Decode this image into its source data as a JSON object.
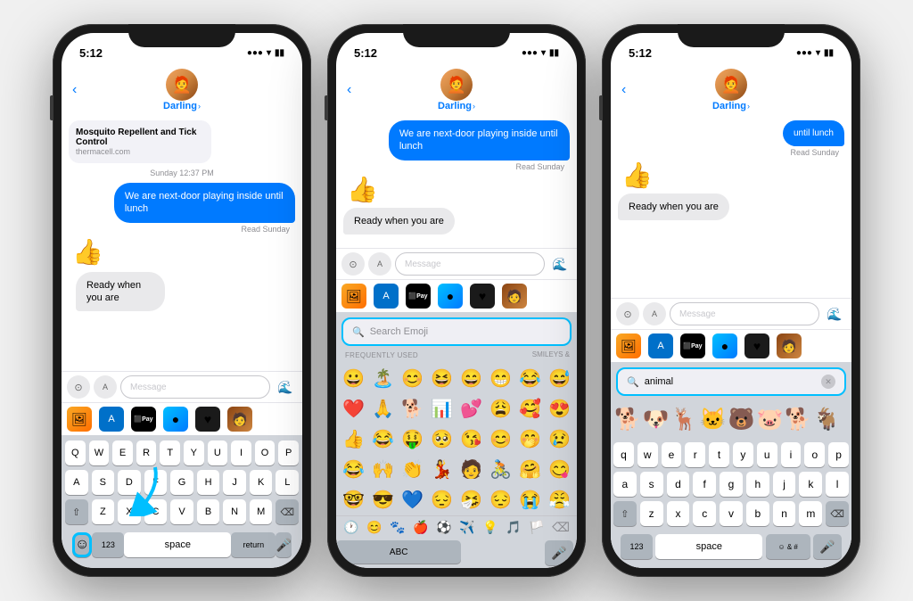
{
  "phones": [
    {
      "id": "phone1",
      "status_time": "5:12",
      "contact": "Darling",
      "messages": [
        {
          "type": "link",
          "title": "Mosquito Repellent and Tick Control",
          "url": "thermacell.com"
        },
        {
          "type": "timestamp",
          "text": "Sunday 12:37 PM"
        },
        {
          "type": "sent",
          "text": "We are next-door playing inside until lunch"
        },
        {
          "type": "read",
          "text": "Read Sunday"
        },
        {
          "type": "thumbs_up"
        },
        {
          "type": "received_plain",
          "text": "Ready when you are"
        }
      ],
      "input_placeholder": "Message",
      "keyboard_type": "alpha",
      "show_emoji_arrow": true,
      "show_app_strip": true
    },
    {
      "id": "phone2",
      "status_time": "5:12",
      "contact": "Darling",
      "messages": [
        {
          "type": "sent",
          "text": "We are next-door playing inside until lunch"
        },
        {
          "type": "read",
          "text": "Read Sunday"
        },
        {
          "type": "thumbs_up"
        },
        {
          "type": "received_plain",
          "text": "Ready when you are"
        }
      ],
      "input_placeholder": "Message",
      "keyboard_type": "emoji",
      "show_app_strip": true,
      "emoji_search_placeholder": "Search Emoji",
      "emoji_sections": {
        "frequently_used": "FREQUENTLY USED",
        "smileys": "SMILEYS &",
        "emojis_row1": [
          "😀",
          "🏝️",
          "😊",
          "😆",
          "😄",
          "😁",
          "😂"
        ],
        "emojis_row2": [
          "❤️",
          "🙏",
          "🐕",
          "📊",
          "💕",
          "😩",
          "🥰"
        ],
        "emojis_row3": [
          "👍",
          "😂",
          "🤑",
          "🥺",
          "😘",
          "😊"
        ],
        "emojis_row4": [
          "😂",
          "🙌",
          "👏",
          "💃",
          "🧑",
          "🚴"
        ],
        "emojis_row5": [
          "🤓",
          "😎",
          "💙",
          "😔",
          "🤧",
          "😔"
        ]
      },
      "emoji_categories": [
        "🕐",
        "😊",
        "🐾",
        "🍎",
        "⚽",
        "✈️",
        "💡",
        "🎵",
        "🏳️",
        "⌫"
      ]
    },
    {
      "id": "phone3",
      "status_time": "5:12",
      "contact": "Darling",
      "messages": [
        {
          "type": "sent",
          "text": "until lunch"
        },
        {
          "type": "read",
          "text": "Read Sunday"
        },
        {
          "type": "thumbs_up"
        },
        {
          "type": "received_plain",
          "text": "Ready when you are"
        }
      ],
      "input_placeholder": "Message",
      "keyboard_type": "emoji_search",
      "show_app_strip": true,
      "emoji_search_value": "animal",
      "animal_emojis": [
        "🐕",
        "🐶",
        "🦌",
        "🐱",
        "🐻",
        "🐷",
        "🐕"
      ],
      "keyboard_rows": [
        [
          "q",
          "w",
          "e",
          "r",
          "t",
          "y",
          "u",
          "i",
          "o",
          "p"
        ],
        [
          "a",
          "s",
          "d",
          "f",
          "g",
          "h",
          "j",
          "k",
          "l"
        ],
        [
          "z",
          "x",
          "c",
          "v",
          "b",
          "n",
          "m"
        ]
      ]
    }
  ],
  "icons": {
    "back": "‹",
    "wifi": "▾",
    "battery": "▮▮▮",
    "signal": "●●●",
    "camera": "⊙",
    "apps": "✦",
    "audio": "🌊",
    "mic": "🎤",
    "emoji_face": "☺",
    "search": "🔍",
    "chevron": "›",
    "keyboard_abc": "ABC",
    "delete": "⌫",
    "shift": "⇧",
    "return": "return",
    "space": "space",
    "num": "123"
  }
}
